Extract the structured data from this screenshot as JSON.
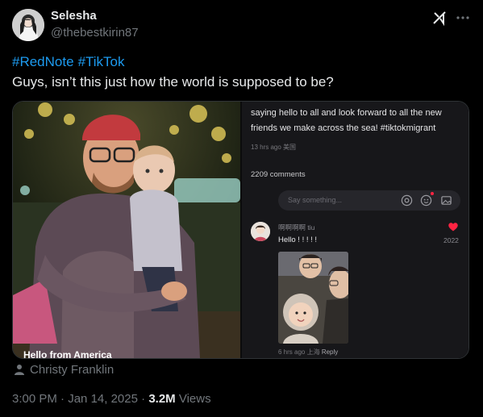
{
  "author": {
    "name": "Selesha",
    "handle": "@thebestkirin87"
  },
  "tweet": {
    "hashtags": [
      "#RedNote",
      "#TikTok"
    ],
    "text": "Guys, isn’t this just how the world is supposed to be?"
  },
  "media": {
    "photo_caption": "Hello from America",
    "rednote_post": {
      "text": "saying hello to all and look forward to all the new friends we make across the sea!  #tiktokmigrant",
      "time_location": "13 hrs ago 美国",
      "comments_count": "2209 comments",
      "input_placeholder": "Say something...",
      "comment": {
        "username": "啊啊啊啊 tiu",
        "text": "Hello ! ! ! ! !",
        "likes": "2022",
        "meta": "6 hrs ago 上海",
        "reply_label": "Reply"
      }
    },
    "credit_name": "Christy Franklin"
  },
  "footer": {
    "time": "3:00 PM",
    "sep1": "·",
    "date": "Jan 14, 2025",
    "sep2": "·",
    "views_count": "3.2M",
    "views_label": "Views"
  },
  "colors": {
    "background": "#000000",
    "link_blue": "#1d9bf0",
    "muted_text": "#71767b",
    "primary_text": "#e7e9ea",
    "rednote_heart": "#ff2442"
  },
  "icons": [
    "grok-icon",
    "more-icon",
    "at-icon",
    "emoji-icon",
    "image-icon",
    "heart-icon",
    "person-icon"
  ]
}
